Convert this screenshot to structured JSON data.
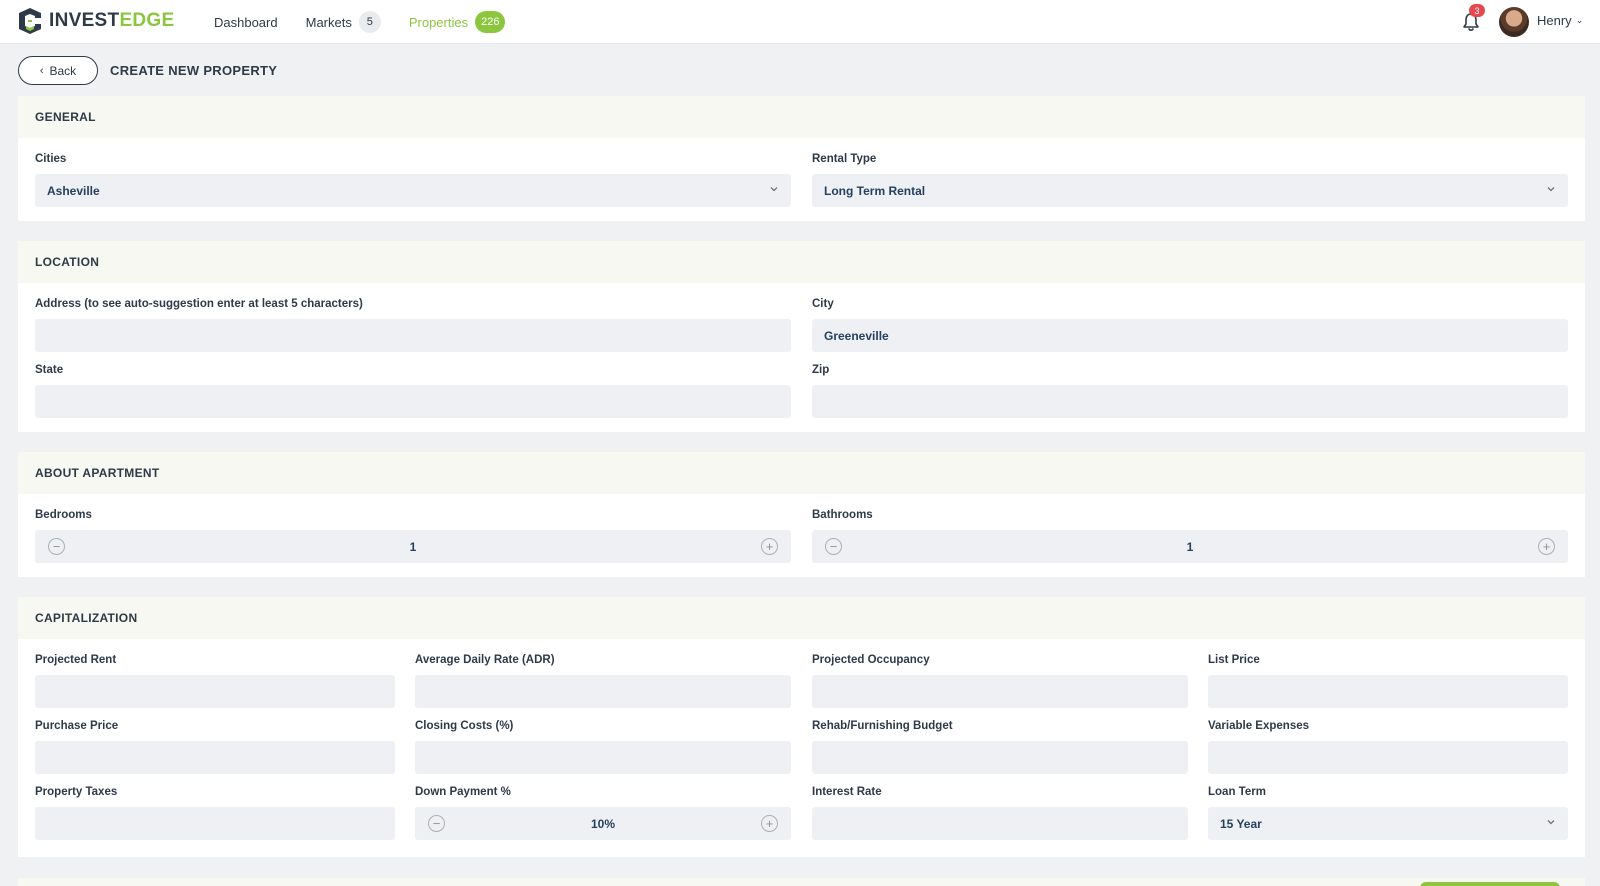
{
  "brand": {
    "name_part1": "INVEST",
    "name_part2": "EDGE",
    "color": "#8cc63f"
  },
  "nav": {
    "dashboard": "Dashboard",
    "markets": "Markets",
    "markets_count": "5",
    "properties": "Properties",
    "properties_count": "226"
  },
  "header": {
    "notifications_count": "3",
    "user_name": "Henry"
  },
  "page": {
    "back_label": "Back",
    "title": "CREATE NEW PROPERTY"
  },
  "general": {
    "title": "GENERAL",
    "cities_label": "Cities",
    "cities_value": "Asheville",
    "rental_type_label": "Rental Type",
    "rental_type_value": "Long Term Rental"
  },
  "location": {
    "title": "LOCATION",
    "address_label": "Address (to see auto-suggestion enter at least 5 characters)",
    "address_value": "",
    "city_label": "City",
    "city_value": "Greeneville",
    "state_label": "State",
    "state_value": "",
    "zip_label": "Zip",
    "zip_value": ""
  },
  "apartment": {
    "title": "ABOUT APARTMENT",
    "bedrooms_label": "Bedrooms",
    "bedrooms_value": "1",
    "bathrooms_label": "Bathrooms",
    "bathrooms_value": "1"
  },
  "capitalization": {
    "title": "CAPITALIZATION",
    "projected_rent_label": "Projected Rent",
    "adr_label": "Average Daily Rate (ADR)",
    "projected_occupancy_label": "Projected Occupancy",
    "list_price_label": "List Price",
    "purchase_price_label": "Purchase Price",
    "closing_costs_label": "Closing Costs (%)",
    "rehab_budget_label": "Rehab/Furnishing Budget",
    "variable_expenses_label": "Variable Expenses",
    "property_taxes_label": "Property Taxes",
    "down_payment_label": "Down Payment %",
    "down_payment_value": "10%",
    "interest_rate_label": "Interest Rate",
    "loan_term_label": "Loan Term",
    "loan_term_value": "15 Year"
  },
  "icons": {
    "logo": "shield-logo-icon",
    "bell": "bell-icon",
    "back": "chevron-left-icon",
    "dropdown": "chevron-down-icon",
    "minus": "minus-circle-icon",
    "plus": "plus-circle-icon"
  }
}
